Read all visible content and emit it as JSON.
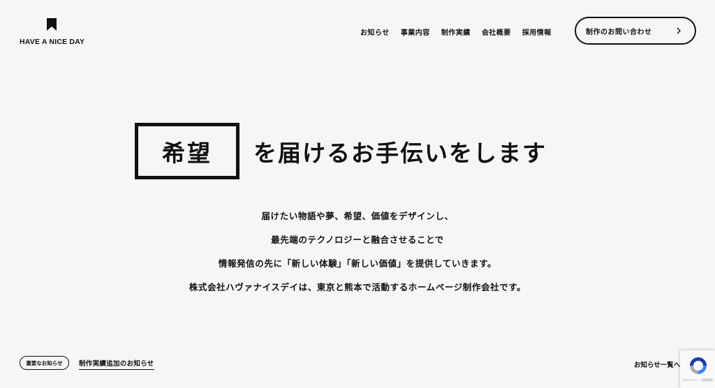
{
  "logo": {
    "text": "HAVE A NICE DAY",
    "icon": "bookmark-icon"
  },
  "nav": {
    "items": [
      {
        "label": "お知らせ"
      },
      {
        "label": "事業内容"
      },
      {
        "label": "制作実績"
      },
      {
        "label": "会社概要"
      },
      {
        "label": "採用情報"
      }
    ],
    "contact_label": "制作のお問い合わせ",
    "contact_icon": "chevron-right-icon"
  },
  "hero": {
    "boxed_word": "希望",
    "rest": "を届けるお手伝いをします"
  },
  "description": {
    "lines": [
      "届けたい物語や夢、希望、価値をデザインし、",
      "最先端のテクノロジーと融合させることで",
      "情報発信の先に「新しい体験」「新しい価値」を提供していきます。",
      "株式会社ハヴァナイスデイは、東京と熊本で活動するホームページ制作会社です。"
    ]
  },
  "news": {
    "badge": "重要なお知らせ",
    "headline": "制作実績追加のお知らせ",
    "list_link": "お知らせ一覧へ"
  },
  "recaptcha": {
    "text": "プライバシー・利用規約",
    "icon": "recaptcha-icon"
  },
  "colors": {
    "background": "#f6f6f6",
    "text": "#111111"
  }
}
